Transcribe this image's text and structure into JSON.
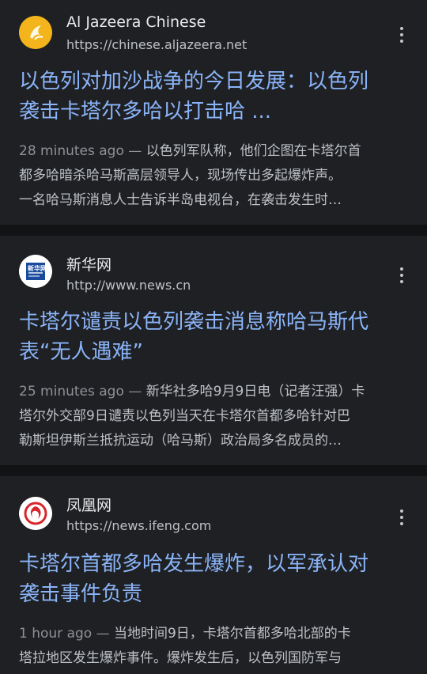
{
  "results": [
    {
      "source_name": "Al Jazeera Chinese",
      "source_url": "https://chinese.aljazeera.net",
      "title_lines": [
        "以色列对加沙战争的今日发展：以色列",
        "袭击卡塔尔多哈以打击哈 ..."
      ],
      "time": "28 minutes ago",
      "dash": " — ",
      "snippet_lines": [
        "以色列军队称，他们企图在卡塔尔首",
        "都多哈暗杀哈马斯高层领导人，现场传出多起爆炸声。",
        "一名哈马斯消息人士告诉半岛电视台，在袭击发生时…"
      ]
    },
    {
      "source_name": "新华网",
      "source_url": "http://www.news.cn",
      "logo_text": "新华网",
      "title_lines": [
        "卡塔尔谴责以色列袭击消息称哈马斯代",
        "表“无人遇难”"
      ],
      "time": "25 minutes ago",
      "dash": " — ",
      "snippet_lines": [
        "新华社多哈9月9日电（记者汪强）卡",
        "塔尔外交部9日谴责以色列当天在卡塔尔首都多哈针对巴",
        "勒斯坦伊斯兰抵抗运动（哈马斯）政治局多名成员的…"
      ]
    },
    {
      "source_name": "凤凰网",
      "source_url": "https://news.ifeng.com",
      "title_lines": [
        "卡塔尔首都多哈发生爆炸，以军承认对",
        "袭击事件负责"
      ],
      "time": "1 hour ago",
      "dash": " — ",
      "snippet_lines": [
        "当地时间9日，卡塔尔首都多哈北部的卡",
        "塔拉地区发生爆炸事件。爆炸发生后，以色列国防军与"
      ]
    }
  ]
}
